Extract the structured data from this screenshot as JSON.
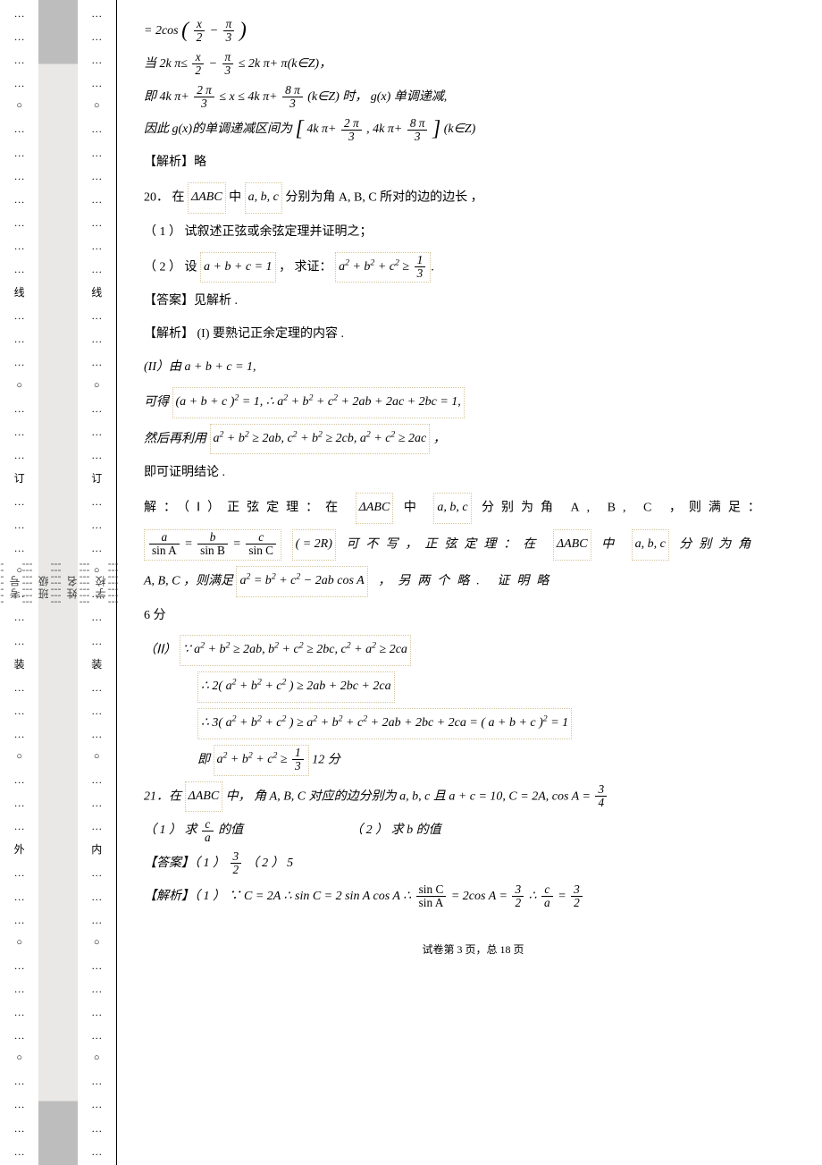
{
  "gutter": {
    "left_words": [
      "线",
      "订",
      "装",
      "外"
    ],
    "right_words": [
      "线",
      "订",
      "装",
      "内"
    ],
    "mid_labels": [
      "考号",
      "班级",
      "姓名",
      "学校"
    ]
  },
  "line1_pre": "=",
  "line1_coeff": "2cos",
  "line1_frac1_num": "x",
  "line1_frac1_den": "2",
  "line1_minus": "−",
  "line1_frac2_num": "π",
  "line1_frac2_den": "3",
  "line2_pre": "当 2k π≤",
  "line2_frac1_num": "x",
  "line2_frac1_den": "2",
  "line2_mid1": "−",
  "line2_frac2_num": "π",
  "line2_frac2_den": "3",
  "line2_post": "≤ 2k π+ π(k∈Z)，",
  "line3_pre": "即 4k π+",
  "line3_frac1_num": "2 π",
  "line3_frac1_den": "3",
  "line3_mid": "≤ x ≤ 4k π+",
  "line3_frac2_num": "8 π",
  "line3_frac2_den": "3",
  "line3_post": "(k∈Z) 时， g(x) 单调递减,",
  "line4_pre": "因此 g(x)的单调递减区间为 ",
  "line4_b1": "4k π+",
  "line4_b1f_num": "2 π",
  "line4_b1f_den": "3",
  "line4_comma": ",  4k π+",
  "line4_b2f_num": "8 π",
  "line4_b2f_den": "3",
  "line4_post": "(k∈Z)",
  "line5": "【解析】略",
  "q20_head": "20．  在 ",
  "q20_tri": "ΔABC",
  "q20_mid": " 中 ",
  "q20_abc": "a, b, c",
  "q20_tail": " 分别为角  A, B, C  所对的边的边长  ，",
  "q20_1": "（ 1 ） 试叙述正弦或余弦定理并证明之；",
  "q20_2a": "（ 2 ） 设 ",
  "q20_2_eq": "a + b + c = 1",
  "q20_2b": "， 求证：",
  "q20_2_ineq_lhs": "a",
  "q20_2_ineq": " + b",
  "q20_2_ineq2": " + c",
  "q20_2_ge": " ≥ ",
  "q20_2_frac_num": "1",
  "q20_2_frac_den": "3",
  "ans_label": "【答案】见解析  .",
  "anal_l1": "【解析】 (I)  要熟记正余定理的内容  .",
  "anal_l2": " (II）由 a + b + c = 1,",
  "step1_pre": "可得 ",
  "step1_eq": "(a + b + c )",
  "step1_post": " = 1, ∴ a",
  "step1_rest": " + b",
  "step1_rest2": " + c",
  "step1_tail": " + 2ab + 2ac + 2bc = 1,",
  "step2_pre": "然后再利用 ",
  "step2_eq": "a",
  "step2_eq2": " + b",
  "step2_eq3": " ≥ 2ab, c",
  "step2_eq4": " + b",
  "step2_eq5": " ≥ 2cb, a",
  "step2_eq6": " + c",
  "step2_eq7": " ≥ 2ac",
  "step2_tail": "，",
  "step3": "即可证明结论  .",
  "sol_I_pre": "解：（Ⅰ）正弦定理：在 ",
  "sol_I_tri": "ΔABC",
  "sol_I_mid": " 中 ",
  "sol_I_abc": "a, b, c",
  "sol_I_tail": " 分别为角 A, B, C ，则满足：",
  "lawsines_a_num": "a",
  "lawsines_a_den": "sin A",
  "lawsines_b_num": "b",
  "lawsines_b_den": "sin B",
  "lawsines_c_num": "c",
  "lawsines_c_den": "sin C",
  "lawsines_eq1": " = ",
  "lawsines_eq2": " = ",
  "lawsines_2R": " ( = 2R)",
  "lawsines_note": " 可不写，正弦定理：在 ",
  "lawsines_tri": "ΔABC",
  "lawsines_note_mid": " 中 ",
  "lawsines_abc": "a, b, c",
  "lawsines_note2": " 分别为角",
  "cos_pre": "A, B, C ，则满足 ",
  "cos_eq": "a",
  "cos_eq_b": " = b",
  "cos_eq_c": " + c",
  "cos_eq_tail": " − 2ab cos A",
  "cos_note": " ，另两个略.  证明略",
  "cos_score": "6 分",
  "II_pre": "（ⅠⅠ） ",
  "II_since": "∵ a",
  "II_l1": " + b",
  "II_l1b": " ≥ 2ab, b",
  "II_l1c": " + c",
  "II_l1d": " ≥ 2bc, c",
  "II_l1e": " + a",
  "II_l1f": " ≥ 2ca",
  "II_l2_pre": "∴ 2( a",
  "II_l2_b": " + b",
  "II_l2_c": " + c",
  "II_l2_tail": ") ≥ 2ab + 2bc + 2ca",
  "II_l3_pre": "∴ 3( a",
  "II_l3_b": " + b",
  "II_l3_c": " + c",
  "II_l3_mid": ") ≥ a",
  "II_l3_mid_b": " + b",
  "II_l3_mid_c": " + c",
  "II_l3_tail": " + 2ab + 2bc + 2ca = ( a + b + c )",
  "II_l3_eq1": " = 1",
  "II_l4_pre": "即 ",
  "II_l4_a": "a",
  "II_l4_b": " + b",
  "II_l4_c": " + c",
  "II_l4_ge": " ≥ ",
  "II_l4_num": "1",
  "II_l4_den": "3",
  "II_l4_score": "  12  分",
  "q21_head": "21．在 ",
  "q21_tri": "ΔABC",
  "q21_mid": " 中， 角 A, B, C 对应的边分别为  a, b, c 且 a + c = 10, C = 2A, cos A = ",
  "q21_frac_num": "3",
  "q21_frac_den": "4",
  "q21_1_pre": "（ 1 ） 求 ",
  "q21_1_num": "c",
  "q21_1_den": "a",
  "q21_1_post": " 的值",
  "q21_2": "（ 2 ） 求 b 的值",
  "q21_ans_pre": "【答案】（ 1 ） ",
  "q21_ans1_num": "3",
  "q21_ans1_den": "2",
  "q21_ans_mid": " （ 2 ） 5",
  "q21_anal_pre": "【解析】（ 1 ） ∵ C = 2A   ∴ sin C = 2 sin A cos A    ∴ ",
  "q21_anal_f1_num": "sin C",
  "q21_anal_f1_den": "sin A",
  "q21_anal_mid": " = 2cos A = ",
  "q21_anal_f2_num": "3",
  "q21_anal_f2_den": "2",
  "q21_anal_so": " ∴ ",
  "q21_anal_f3_num": "c",
  "q21_anal_f3_den": "a",
  "q21_anal_eq": " = ",
  "q21_anal_f4_num": "3",
  "q21_anal_f4_den": "2",
  "footer": "试卷第 3 页，总 18 页"
}
